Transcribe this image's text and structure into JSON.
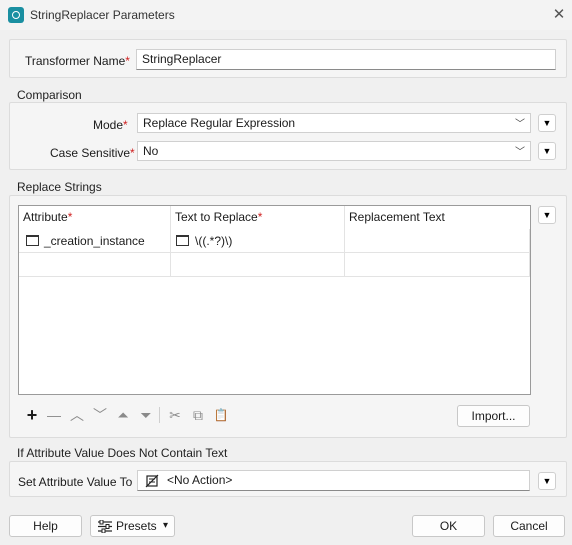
{
  "window": {
    "title": "StringReplacer Parameters",
    "close": "✕"
  },
  "transformer": {
    "label": "Transformer Name",
    "required": "*",
    "value": "StringReplacer"
  },
  "comparison": {
    "title": "Comparison",
    "mode_label": "Mode",
    "mode_required": "*",
    "mode_value": "Replace Regular Expression",
    "case_label": "Case Sensitive",
    "case_required": "*",
    "case_value": "No"
  },
  "replace": {
    "title": "Replace Strings",
    "columns": [
      "Attribute",
      "Text to Replace",
      "Replacement Text"
    ],
    "col_required": "*",
    "rows": [
      {
        "attribute": "_creation_instance",
        "text_to_replace": "\\((.*?)\\)",
        "replacement": ""
      }
    ],
    "import_label": "Import...",
    "toolbar": {
      "add": "+",
      "remove": "—",
      "up": "︿",
      "down": "﹀",
      "top": "⏶",
      "bottom": "⏷",
      "cut": "✂",
      "copy": "⧉",
      "paste": "📋"
    }
  },
  "if_attr": {
    "title": "If Attribute Value Does Not Contain Text",
    "label": "Set Attribute Value To",
    "value": "<No Action>"
  },
  "footer": {
    "help": "Help",
    "presets": "Presets",
    "ok": "OK",
    "cancel": "Cancel"
  },
  "icons": {
    "chevron": "﹀",
    "dropdown": "▼",
    "caret": "▾"
  }
}
